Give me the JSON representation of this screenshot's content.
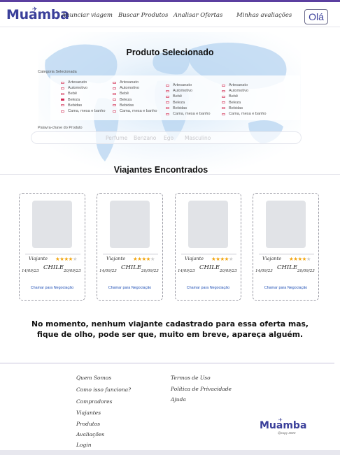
{
  "header": {
    "logo": "Muamba",
    "nav": [
      "Anunciar viagem",
      "Buscar Produtos",
      "Analisar Ofertas",
      "Minhas avaliações"
    ],
    "greeting_button": "Olá"
  },
  "product": {
    "title": "Produto Selecionado",
    "category_label": "Categoria Selecionada",
    "category_columns": [
      [
        {
          "label": "Artesanato",
          "checked": false
        },
        {
          "label": "Automotivo",
          "checked": false
        },
        {
          "label": "Bebê",
          "checked": false
        },
        {
          "label": "Beleza",
          "checked": true
        },
        {
          "label": "Bebidas",
          "checked": false
        },
        {
          "label": "Cama, mesa e banho",
          "checked": false
        }
      ],
      [
        {
          "label": "Artesanato",
          "checked": false
        },
        {
          "label": "Automotivo",
          "checked": false
        },
        {
          "label": "Bebê",
          "checked": false
        },
        {
          "label": "Beleza",
          "checked": false
        },
        {
          "label": "Bebidas",
          "checked": false
        },
        {
          "label": "Cama, mesa e banho",
          "checked": false
        }
      ],
      [
        {
          "label": "Artesanato",
          "checked": false
        },
        {
          "label": "Automotivo",
          "checked": false
        },
        {
          "label": "Bebê",
          "checked": false
        },
        {
          "label": "Beleza",
          "checked": false
        },
        {
          "label": "Bebidas",
          "checked": false
        },
        {
          "label": "Cama, mesa e banho",
          "checked": false
        }
      ],
      [
        {
          "label": "Artesanato",
          "checked": false
        },
        {
          "label": "Automotivo",
          "checked": false
        },
        {
          "label": "Bebê",
          "checked": false
        },
        {
          "label": "Beleza",
          "checked": false
        },
        {
          "label": "Bebidas",
          "checked": false
        },
        {
          "label": "Cama, mesa e banho",
          "checked": false
        }
      ]
    ],
    "keyword_label": "Palavra-chave do Produto",
    "keywords": [
      "Perfume",
      "Benzano",
      "Ego",
      "Masculino"
    ]
  },
  "travelers": {
    "title": "Viajantes Encontrados",
    "cards": [
      {
        "name": "Viajante",
        "rating": 4,
        "max_rating": 5,
        "departure": "14/09/23",
        "country": "CHILE",
        "return": "20/09/23",
        "action": "Chamar para Negociação"
      },
      {
        "name": "Viajante",
        "rating": 4,
        "max_rating": 5,
        "departure": "14/09/23",
        "country": "CHILE",
        "return": "20/09/23",
        "action": "Chamar para Negociação"
      },
      {
        "name": "Viajante",
        "rating": 4,
        "max_rating": 5,
        "departure": "14/09/23",
        "country": "CHILE",
        "return": "20/09/23",
        "action": "Chamar para Negociação"
      },
      {
        "name": "Viajante",
        "rating": 4,
        "max_rating": 5,
        "departure": "14/09/23",
        "country": "CHILE",
        "return": "20/09/23",
        "action": "Chamar para Negociação"
      }
    ]
  },
  "notice": {
    "line1": "No momento, nenhum viajante cadastrado para essa oferta mas,",
    "line2": "fique de olho, pode ser que, muito em breve, apareça alguém."
  },
  "footer": {
    "col1": [
      "Quem Somos",
      "Como isso funciona?",
      "Compradores",
      "Viajantes",
      "Produtos",
      "Avaliações",
      "Login"
    ],
    "col2": [
      "Termos de Uso",
      "Política de Privacidade",
      "Ajuda"
    ],
    "logo": "Muamba",
    "copyright": "@copy 2023"
  },
  "colors": {
    "brand": "#3a3f9a",
    "accent_bar": "#5b3fa0",
    "checkbox_on": "#d42a55",
    "star": "#f2a50f",
    "link": "#1f4fb5"
  }
}
